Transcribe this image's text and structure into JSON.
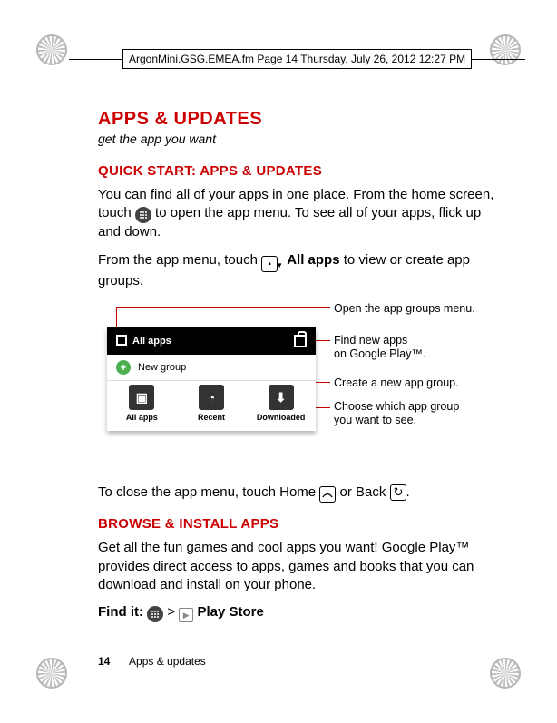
{
  "running_header": "ArgonMini.GSG.EMEA.fm  Page 14  Thursday, July 26, 2012  12:27 PM",
  "title": "APPS & UPDATES",
  "subtitle": "get the app you want",
  "quick_heading": "QUICK START: APPS & UPDATES",
  "para1a": "You can find all of your apps in one place. From the home screen, touch ",
  "para1b": " to open the app menu. To see all of your apps, flick up and down.",
  "para2a": "From the app menu, touch ",
  "para2_bold": "All apps",
  "para2b": " to view or create app groups.",
  "diagram": {
    "topbar_label": "All apps",
    "newgroup_label": "New group",
    "tabs": {
      "all": "All apps",
      "recent": "Recent",
      "downloaded": "Downloaded"
    },
    "callouts": {
      "open_menu": "Open the app groups menu.",
      "find_new1": "Find new apps",
      "find_new2": "on Google Play™.",
      "create_group": "Create a new app group.",
      "choose1": "Choose which app group",
      "choose2": "you want to see."
    }
  },
  "para3a": "To close the app menu, touch Home ",
  "para3b": " or Back ",
  "para3c": ".",
  "browse_heading": "BROWSE & INSTALL APPS",
  "para4": "Get all the fun games and cool apps you want! Google Play™ provides direct access to apps, games and books that you can download and install on your phone.",
  "findit_label": "Find it:",
  "findit_path": " Play Store",
  "footer": {
    "page_number": "14",
    "section": "Apps & updates"
  }
}
